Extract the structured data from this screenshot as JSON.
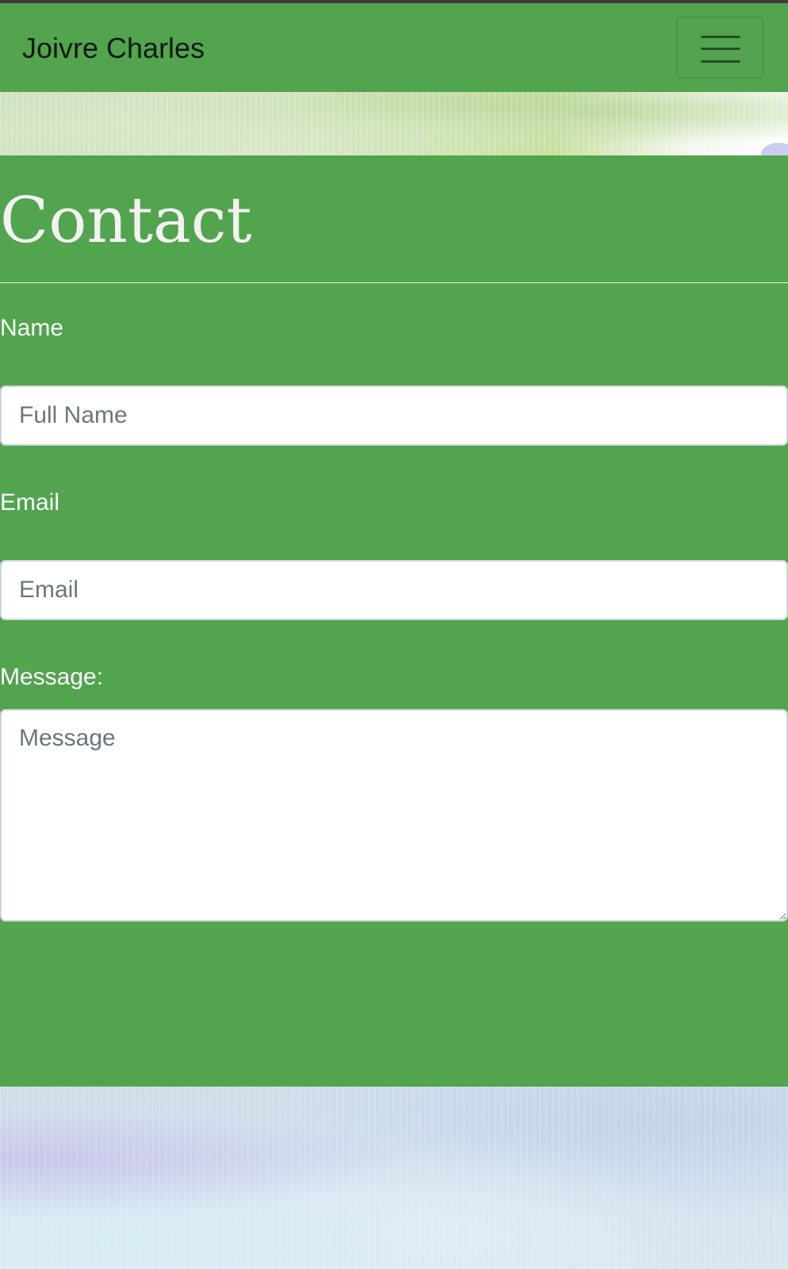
{
  "navbar": {
    "brand": "Joivre Charles",
    "toggler_icon": "hamburger-menu-icon"
  },
  "contact": {
    "title": "Contact",
    "name_label": "Name",
    "name_placeholder": "Full Name",
    "email_label": "Email",
    "email_placeholder": "Email",
    "message_label": "Message:",
    "message_placeholder": "Message"
  },
  "colors": {
    "accent_green": "#52a44e",
    "title_text": "#f2f2f2",
    "label_text": "#ffffff",
    "placeholder_text": "#6c757d"
  }
}
